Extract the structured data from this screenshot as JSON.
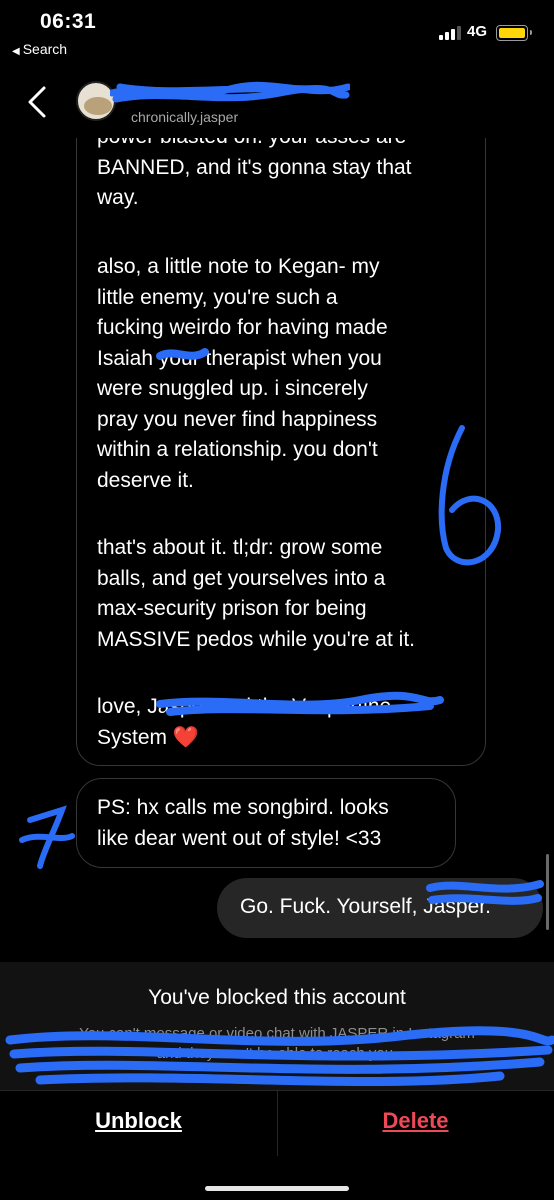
{
  "status_bar": {
    "time": "06:31",
    "back_label": "Search",
    "network": "4G",
    "battery_color": "#ffd60a"
  },
  "header": {
    "back_icon": "chevron-left-icon",
    "username": "chronically.jasper"
  },
  "messages": {
    "long_message_paragraphs": [
      "power blasted on. your asses are\nBANNED, and it's gonna stay that\nway.",
      "also, a little note to Kegan- my\nlittle enemy, you're such a\nfucking weirdo for having made\nIsaiah your therapist when you\nwere snuggled up. i sincerely\npray you never find happiness\nwithin a relationship. you don't\ndeserve it.",
      "that's about it. tl;dr: grow some\nballs, and get yourselves into a\nmax-security prison for being\nMASSIVE pedos while you're at it.",
      "love, Jasper and the Vespertine\nSystem ❤️"
    ],
    "ps_message": "PS: hx calls me songbird. looks\nlike dear went out of style! <33",
    "outgoing_message": "Go. Fuck. Yourself, Jasper."
  },
  "annotations": {
    "number_6": "6",
    "number_7": "7",
    "scribble_color": "#1f6bff"
  },
  "blocked_banner": {
    "title": "You've blocked this account",
    "subtitle": "You can't message or video chat with JASPER in Instagram\nand they won't be able to reach you."
  },
  "footer": {
    "unblock_label": "Unblock",
    "delete_label": "Delete",
    "delete_color": "#ed4956"
  }
}
